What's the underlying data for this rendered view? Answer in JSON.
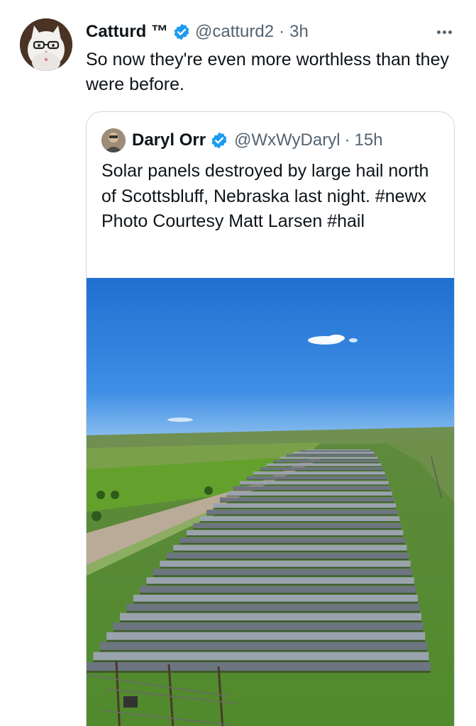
{
  "tweet": {
    "author_name": "Catturd ™",
    "author_handle": "@catturd2",
    "separator": "·",
    "time": "3h",
    "text": "So now they're even more worthless than they were before."
  },
  "quoted_tweet": {
    "author_name": "Daryl Orr",
    "author_handle": "@WxWyDaryl",
    "separator": "·",
    "time": "15h",
    "text": "Solar panels destroyed by large hail north of Scottsbluff, Nebraska last night. #newx Photo Courtesy Matt Larsen #hail"
  },
  "icons": {
    "verified": "verified-badge-icon",
    "more": "more-options-icon"
  },
  "colors": {
    "verified_blue": "#1d9bf0",
    "secondary_text": "#536471",
    "border": "#cfd9de"
  }
}
